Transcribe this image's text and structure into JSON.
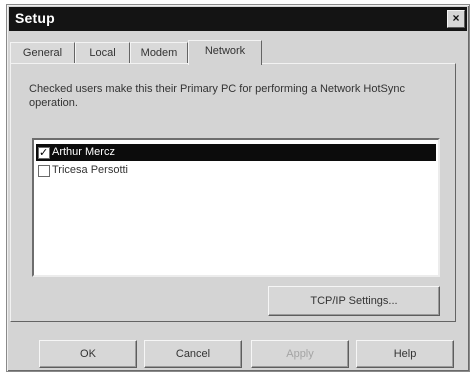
{
  "window": {
    "title": "Setup",
    "close_glyph": "×"
  },
  "tabs": [
    {
      "label": "General"
    },
    {
      "label": "Local"
    },
    {
      "label": "Modem"
    },
    {
      "label": "Network"
    }
  ],
  "network": {
    "description": "Checked users make this their Primary PC for performing a Network HotSync operation.",
    "users": [
      {
        "label": "Arthur Mercz",
        "checked": true,
        "selected": true
      },
      {
        "label": "Tricesa Persotti",
        "checked": false,
        "selected": false
      }
    ],
    "tcp_button": "TCP/IP Settings..."
  },
  "buttons": {
    "ok": "OK",
    "cancel": "Cancel",
    "apply": "Apply",
    "help": "Help"
  },
  "colors": {
    "titlebar": "#141414",
    "dialog_bg": "#d4d4d4",
    "selection": "#0c0c0c"
  }
}
